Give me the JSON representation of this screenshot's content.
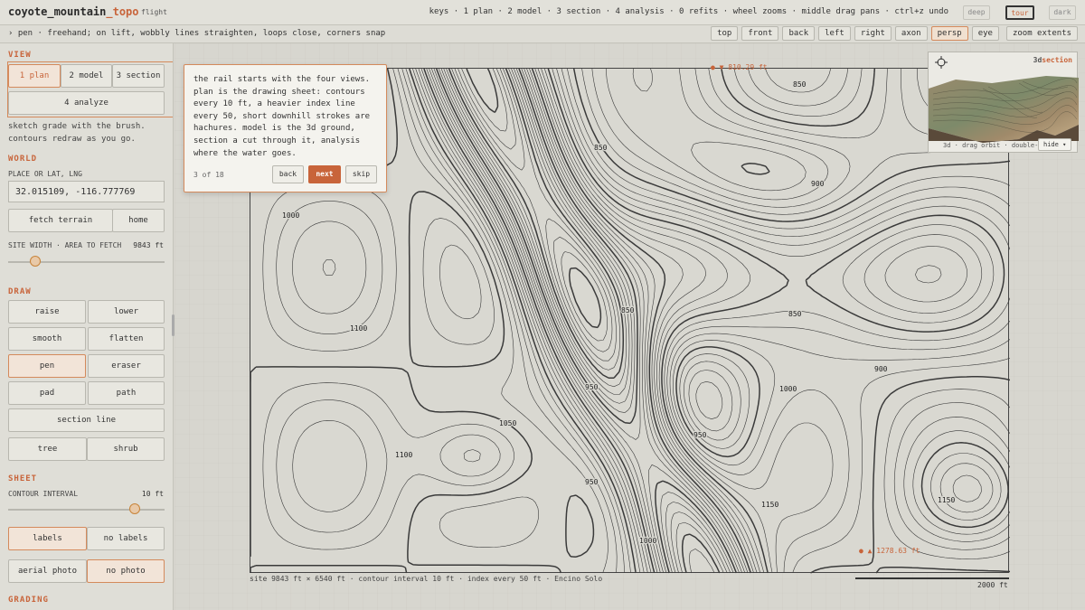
{
  "app": {
    "title_main": "coyote_mountain",
    "title_accent": "_topo",
    "subtitle": "flight",
    "keys": "keys · 1 plan · 2 model · 3 section · 4 analysis · 0 refits · wheel zooms · middle drag pans · ctrl+z undo",
    "modes": [
      "deep",
      "tour",
      "dark"
    ],
    "active_mode": "tour"
  },
  "toolbar": {
    "status": "› pen · freehand; on lift, wobbly lines straighten, loops close, corners snap",
    "views": [
      "top",
      "front",
      "back",
      "left",
      "right",
      "axon",
      "persp",
      "eye"
    ],
    "active_view": "persp",
    "zoom_extents": "zoom extents"
  },
  "sidebar": {
    "view_title": "VIEW",
    "view_buttons": [
      "1 plan",
      "2 model",
      "3 section"
    ],
    "analyze": "4 analyze",
    "hint_line1": "sketch grade with the brush.",
    "hint_line2": "contours redraw as you go.",
    "world_title": "WORLD",
    "place_label": "PLACE OR LAT, LNG",
    "latlng": "32.015109, -116.777769",
    "fetch_terrain": "fetch terrain",
    "home": "home",
    "site_width_label": "SITE WIDTH · AREA TO FETCH",
    "site_width_value": "9843 ft",
    "site_width_fraction": 0.18,
    "draw_title": "DRAW",
    "draw_tools": [
      "raise",
      "lower",
      "smooth",
      "flatten",
      "pen",
      "eraser",
      "pad",
      "path"
    ],
    "active_tool": "pen",
    "section_line": "section line",
    "tree": "tree",
    "shrub": "shrub",
    "sheet_title": "SHEET",
    "contour_label": "CONTOUR INTERVAL",
    "contour_value": "10 ft",
    "contour_fraction": 0.8,
    "labels": "labels",
    "no_labels": "no labels",
    "aerial_photo": "aerial photo",
    "no_photo": "no photo",
    "grading_title": "GRADING"
  },
  "tour": {
    "text": "the rail starts with the four views. plan is the drawing sheet: contours every 10 ft, a heavier index line every 50, short downhill strokes are hachures. model is the 3d ground, section a cut through it, analysis where the water goes.",
    "step": "3 of 18",
    "back": "back",
    "next": "next",
    "skip": "skip"
  },
  "canvas": {
    "low_marker": "● ▼ 810.29 ft",
    "high_marker": "● ▲ 1278.63 ft",
    "footer": "site 9843 ft × 6540 ft · contour interval 10 ft · index every 50 ft · Encino Solo",
    "scale_label": "2000 ft",
    "contour_labels": [
      "850",
      "900",
      "950",
      "1000",
      "1050",
      "1100",
      "1150"
    ]
  },
  "inset": {
    "label_prefix": "3d",
    "label_accent": "section",
    "footer": "3d · drag orbit · double-",
    "hide": "hide ▾"
  },
  "colors": {
    "accent": "#c8643a",
    "contour": "#3a3a3a",
    "panel": "#dfded7"
  }
}
